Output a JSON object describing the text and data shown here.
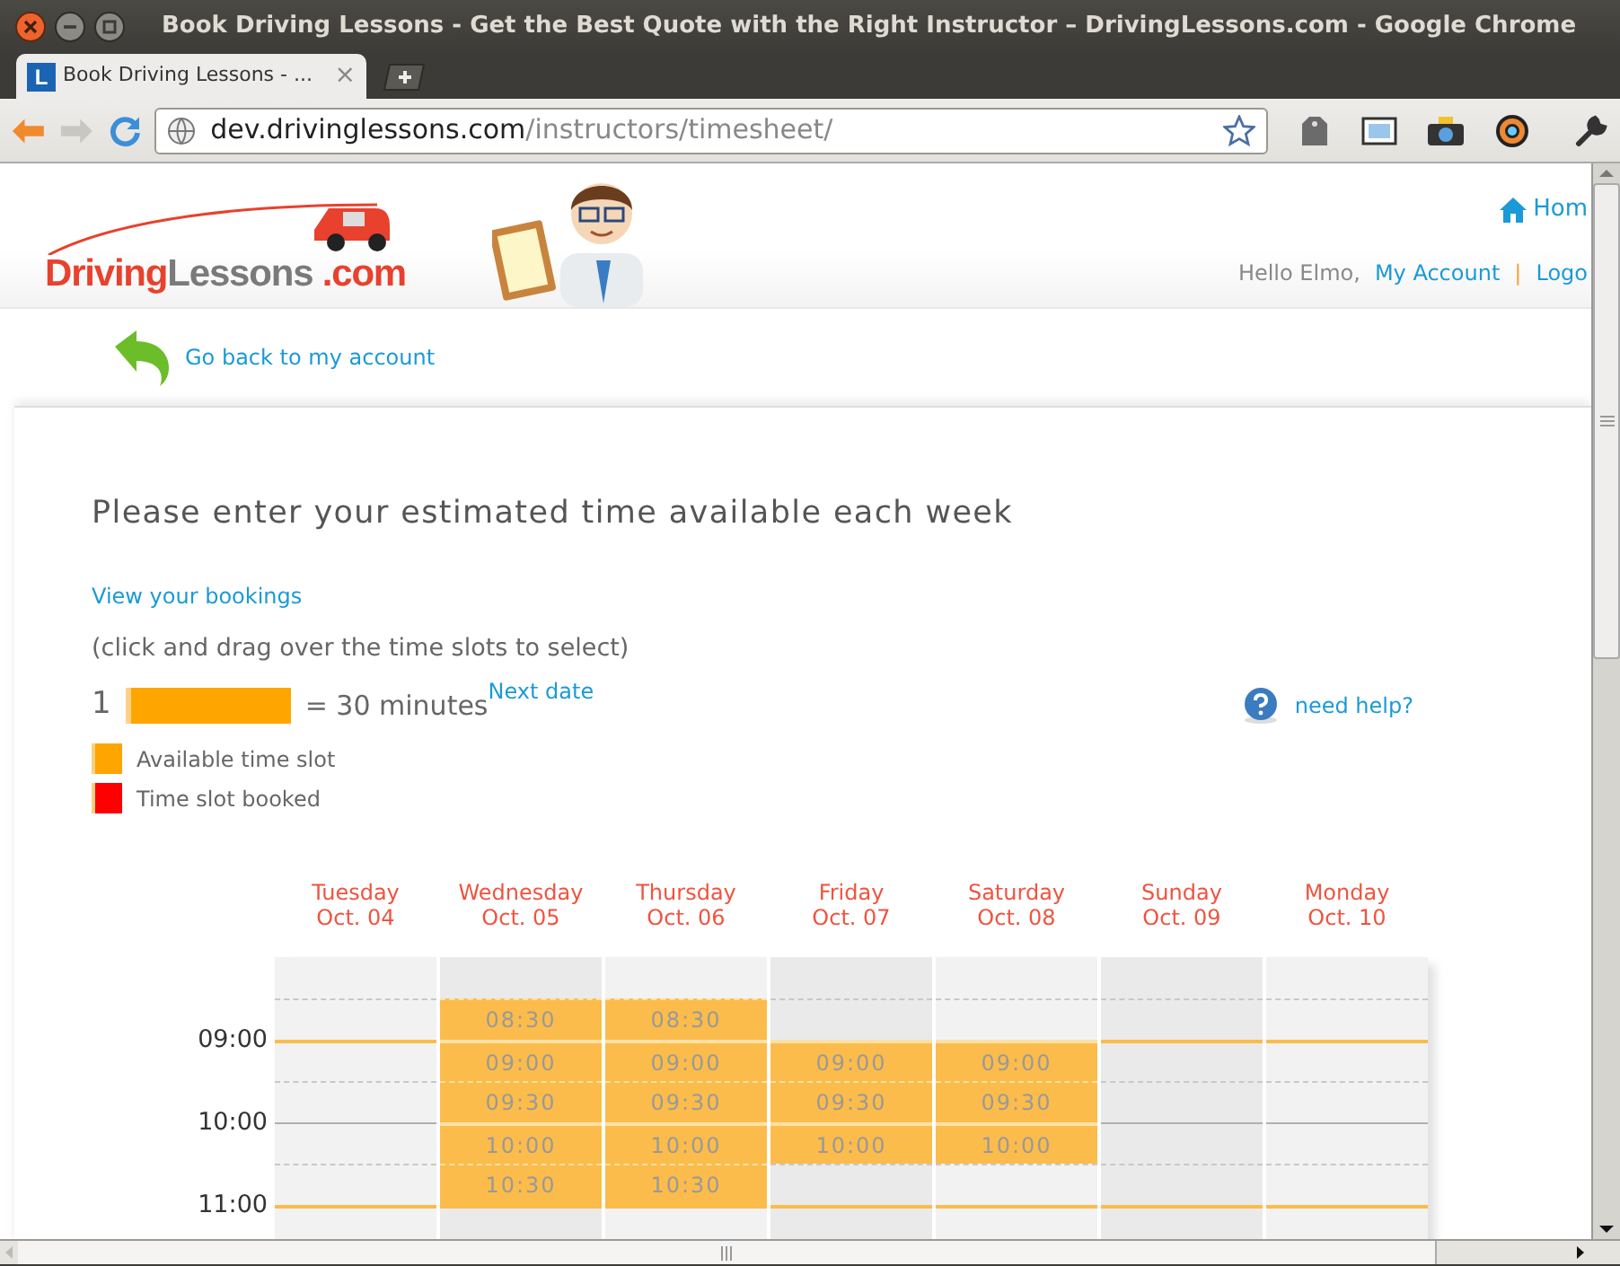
{
  "window": {
    "title": "Book Driving Lessons - Get the Best Quote with the Right Instructor – DrivingLessons.com - Google Chrome"
  },
  "tabs": [
    {
      "icon_letter": "L",
      "label": "Book Driving Lessons - ...",
      "close": "×",
      "selected": true
    }
  ],
  "address_bar": {
    "host": "dev.drivinglessons.com",
    "path": "/instructors/timesheet/"
  },
  "logo": [
    {
      "text": "Driving",
      "color": "#e8412e"
    },
    {
      "text": "Lessons",
      "color": "#7a7a7a"
    },
    {
      "text": " .com",
      "color": "#e8412e"
    }
  ],
  "user_nav": {
    "home": "Hom",
    "greeting": "Hello Elmo,",
    "account": "My Account",
    "separator": "|",
    "logout": "Logo"
  },
  "back_link": "Go back to my account",
  "heading": "Please enter your estimated time available each week",
  "bookings_link": "View your bookings",
  "instruction": "(click and drag over the time slots to select)",
  "scale": {
    "count": "1",
    "equals": "= 30 minutes"
  },
  "next_date": "Next date",
  "help": "need help?",
  "legend": [
    {
      "label": "Available time slot",
      "color": "#ffa500"
    },
    {
      "label": "Time slot booked",
      "color": "#ff0000"
    }
  ],
  "timesheet": {
    "hour_labels": [
      "09:00",
      "10:00",
      "11:00"
    ],
    "days": [
      {
        "name": "Tuesday",
        "date": "Oct. 04",
        "slots": [
          {
            "available": false
          },
          {
            "available": false
          },
          {
            "available": false
          },
          {
            "available": false
          },
          {
            "available": false
          },
          {
            "available": false
          },
          {
            "available": false
          }
        ]
      },
      {
        "name": "Wednesday",
        "date": "Oct. 05",
        "slots": [
          {
            "available": false
          },
          {
            "available": true,
            "time": "08:30"
          },
          {
            "available": true,
            "time": "09:00"
          },
          {
            "available": true,
            "time": "09:30"
          },
          {
            "available": true,
            "time": "10:00"
          },
          {
            "available": true,
            "time": "10:30"
          },
          {
            "available": false
          }
        ]
      },
      {
        "name": "Thursday",
        "date": "Oct. 06",
        "slots": [
          {
            "available": false
          },
          {
            "available": true,
            "time": "08:30"
          },
          {
            "available": true,
            "time": "09:00"
          },
          {
            "available": true,
            "time": "09:30"
          },
          {
            "available": true,
            "time": "10:00"
          },
          {
            "available": true,
            "time": "10:30"
          },
          {
            "available": false
          }
        ]
      },
      {
        "name": "Friday",
        "date": "Oct. 07",
        "slots": [
          {
            "available": false
          },
          {
            "available": false
          },
          {
            "available": true,
            "time": "09:00"
          },
          {
            "available": true,
            "time": "09:30"
          },
          {
            "available": true,
            "time": "10:00"
          },
          {
            "available": false
          },
          {
            "available": false
          }
        ]
      },
      {
        "name": "Saturday",
        "date": "Oct. 08",
        "slots": [
          {
            "available": false
          },
          {
            "available": false
          },
          {
            "available": true,
            "time": "09:00"
          },
          {
            "available": true,
            "time": "09:30"
          },
          {
            "available": true,
            "time": "10:00"
          },
          {
            "available": false
          },
          {
            "available": false
          }
        ]
      },
      {
        "name": "Sunday",
        "date": "Oct. 09",
        "slots": [
          {
            "available": false
          },
          {
            "available": false
          },
          {
            "available": false
          },
          {
            "available": false
          },
          {
            "available": false
          },
          {
            "available": false
          },
          {
            "available": false
          }
        ]
      },
      {
        "name": "Monday",
        "date": "Oct. 10",
        "slots": [
          {
            "available": false
          },
          {
            "available": false
          },
          {
            "available": false
          },
          {
            "available": false
          },
          {
            "available": false
          },
          {
            "available": false
          },
          {
            "available": false
          }
        ]
      }
    ]
  }
}
